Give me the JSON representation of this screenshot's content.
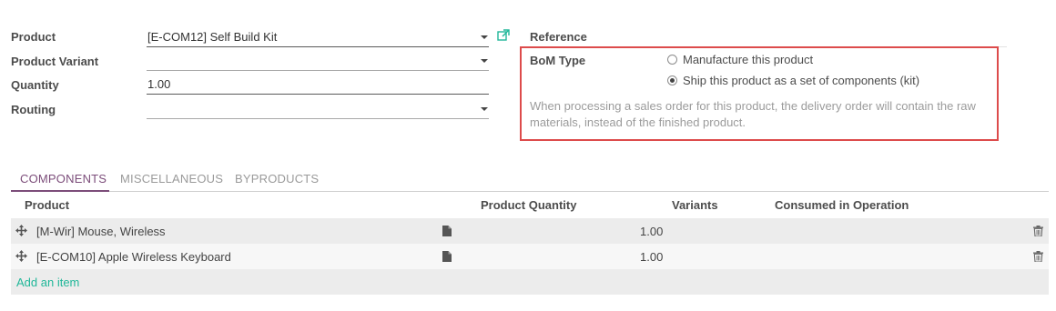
{
  "form": {
    "product": {
      "label": "Product",
      "value": "[E-COM12] Self Build Kit"
    },
    "product_variant": {
      "label": "Product Variant",
      "value": ""
    },
    "quantity": {
      "label": "Quantity",
      "value": "1.00"
    },
    "routing": {
      "label": "Routing",
      "value": ""
    },
    "reference": {
      "label": "Reference",
      "value": ""
    },
    "bom_type": {
      "label": "BoM Type",
      "options": [
        {
          "label": "Manufacture this product",
          "checked": false
        },
        {
          "label": "Ship this product as a set of components (kit)",
          "checked": true
        }
      ],
      "help": "When processing a sales order for this product, the delivery order will contain the raw materials, instead of the finished product."
    }
  },
  "tabs": [
    {
      "label": "COMPONENTS",
      "active": true
    },
    {
      "label": "MISCELLANEOUS",
      "active": false
    },
    {
      "label": "BYPRODUCTS",
      "active": false
    }
  ],
  "table": {
    "columns": [
      "Product",
      "Product Quantity",
      "Variants",
      "Consumed in Operation"
    ],
    "rows": [
      {
        "product": "[M-Wir] Mouse, Wireless",
        "quantity": "1.00",
        "variants": "",
        "operation": ""
      },
      {
        "product": "[E-COM10] Apple Wireless Keyboard",
        "quantity": "1.00",
        "variants": "",
        "operation": ""
      }
    ],
    "add_item": "Add an item"
  },
  "colors": {
    "accent_tab": "#7c4d7a",
    "link": "#21b799",
    "highlight": "#dd4b4b"
  }
}
